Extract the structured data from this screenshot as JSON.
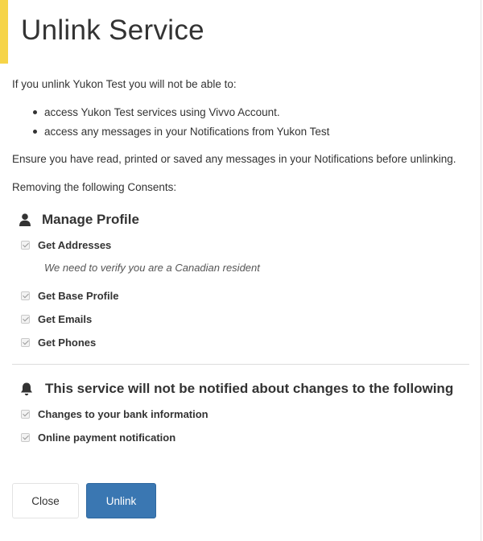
{
  "header": {
    "title": "Unlink Service"
  },
  "intro": "If you unlink Yukon Test you will not be able to:",
  "bullets": [
    "access Yukon Test services using Vivvo Account.",
    "access any messages in your Notifications from Yukon Test"
  ],
  "ensure_text": "Ensure you have read, printed or saved any messages in your Notifications before unlinking.",
  "removing_text": "Removing the following Consents:",
  "manage_profile": {
    "icon": "user-icon",
    "heading": "Manage Profile",
    "items": [
      {
        "label": "Get Addresses",
        "checked": true
      },
      {
        "label": "Get Base Profile",
        "checked": true
      },
      {
        "label": "Get Emails",
        "checked": true
      },
      {
        "label": "Get Phones",
        "checked": true
      }
    ],
    "addresses_note": "We need to verify you are a Canadian resident"
  },
  "notifications": {
    "icon": "bell-icon",
    "heading": "This service will not be notified about changes to the following",
    "items": [
      {
        "label": "Changes to your bank information",
        "checked": true
      },
      {
        "label": "Online payment notification",
        "checked": true
      }
    ]
  },
  "footer": {
    "close_label": "Close",
    "unlink_label": "Unlink"
  },
  "colors": {
    "accent": "#f6d448",
    "primary_button": "#3a77b2"
  }
}
